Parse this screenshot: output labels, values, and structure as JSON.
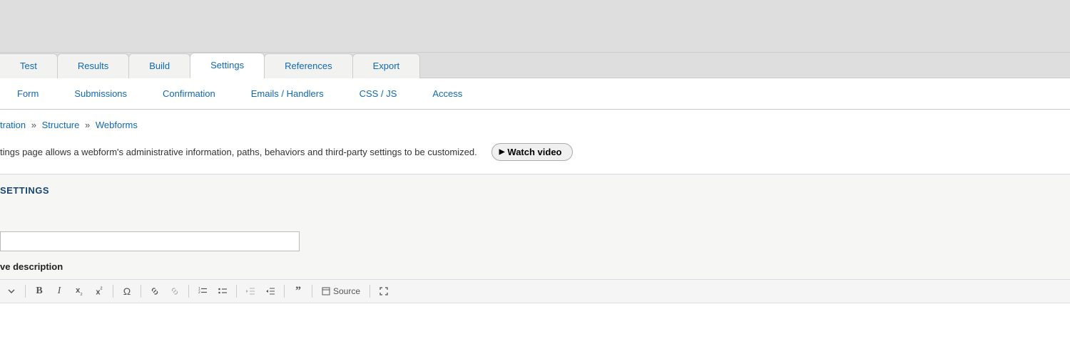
{
  "primary_tabs": {
    "t0": "Test",
    "t1": "Results",
    "t2": "Build",
    "t3": "Settings",
    "t4": "References",
    "t5": "Export"
  },
  "secondary_tabs": {
    "s0": "Form",
    "s1": "Submissions",
    "s2": "Confirmation",
    "s3": "Emails / Handlers",
    "s4": "CSS / JS",
    "s5": "Access"
  },
  "breadcrumb": {
    "b0_partial": "tration",
    "b1": "Structure",
    "b2": "Webforms",
    "sep": "»"
  },
  "description": "tings page allows a webform's administrative information, paths, behaviors and third-party settings to be customized.",
  "watch_video_label": "Watch video",
  "panel_heading": "SETTINGS",
  "field_label": "ve description",
  "editor": {
    "source_label": "Source"
  }
}
